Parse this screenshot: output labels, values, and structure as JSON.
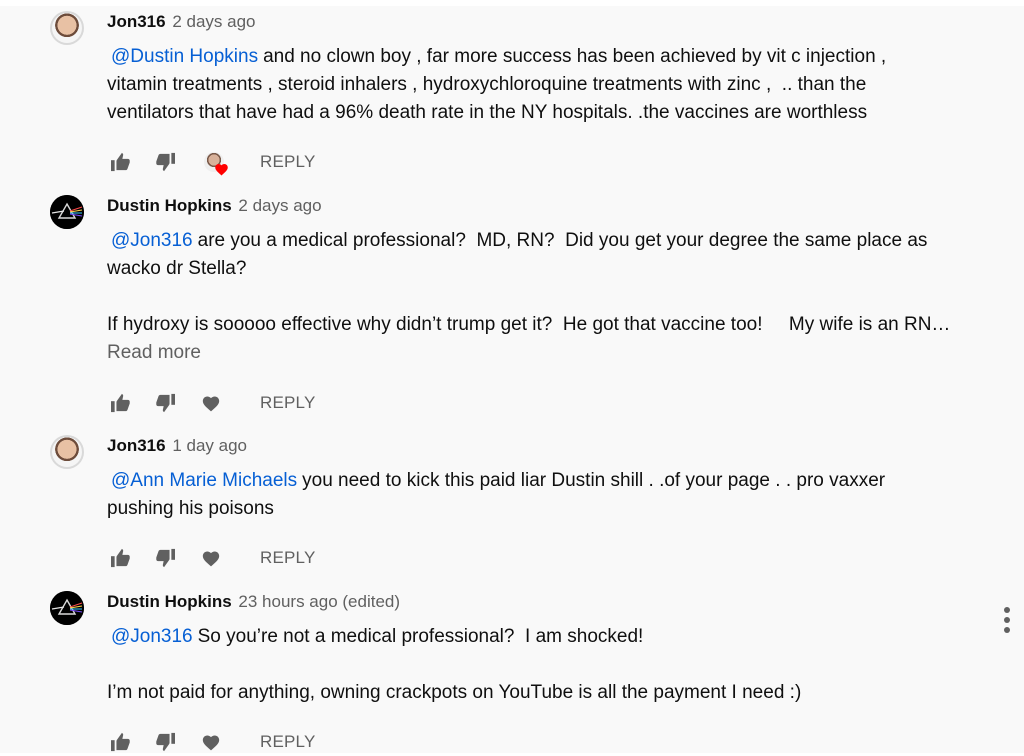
{
  "comments": [
    {
      "author": "Jon316",
      "time": "2 days ago",
      "mention": "@Dustin Hopkins",
      "text": "and no clown boy , far more success has been achieved by vit c injection ,\nvitamin treatments , steroid inhalers , hydroxychloroquine treatments with zinc ,  .. than the\nventilators that have had a 96% death rate in the NY hospitals. .the vaccines are worthless",
      "reply_label": "REPLY",
      "hearted": true
    },
    {
      "author": "Dustin Hopkins",
      "time": "2 days ago",
      "mention": "@Jon316",
      "text": "are you a medical professional?  MD, RN?  Did you get your degree the same place as\nwacko dr Stella?\n\nIf hydroxy is sooooo effective why didn’t trump get it?  He got that vaccine too!     My wife is an RN…",
      "read_more": "Read more",
      "reply_label": "REPLY",
      "hearted": false
    },
    {
      "author": "Jon316",
      "time": "1 day ago",
      "mention": "@Ann Marie Michaels",
      "text": "you need to kick this paid liar Dustin shill . .of your page . . pro vaxxer\npushing his poisons",
      "reply_label": "REPLY",
      "hearted": false
    },
    {
      "author": "Dustin Hopkins",
      "time": "23 hours ago (edited)",
      "mention": "@Jon316",
      "text": "So you’re not a medical professional?  I am shocked!\n\nI’m not paid for anything, owning crackpots on YouTube is all the payment I need :)",
      "reply_label": "REPLY",
      "hearted": false
    }
  ],
  "icons": {
    "like": "thumbs-up-icon",
    "dislike": "thumbs-down-icon",
    "heart": "heart-icon",
    "menu": "more-vertical-icon"
  },
  "colors": {
    "background": "#f9f9f9",
    "link": "#065fd4",
    "secondary_text": "#606060",
    "heart_red": "#ff0000"
  }
}
